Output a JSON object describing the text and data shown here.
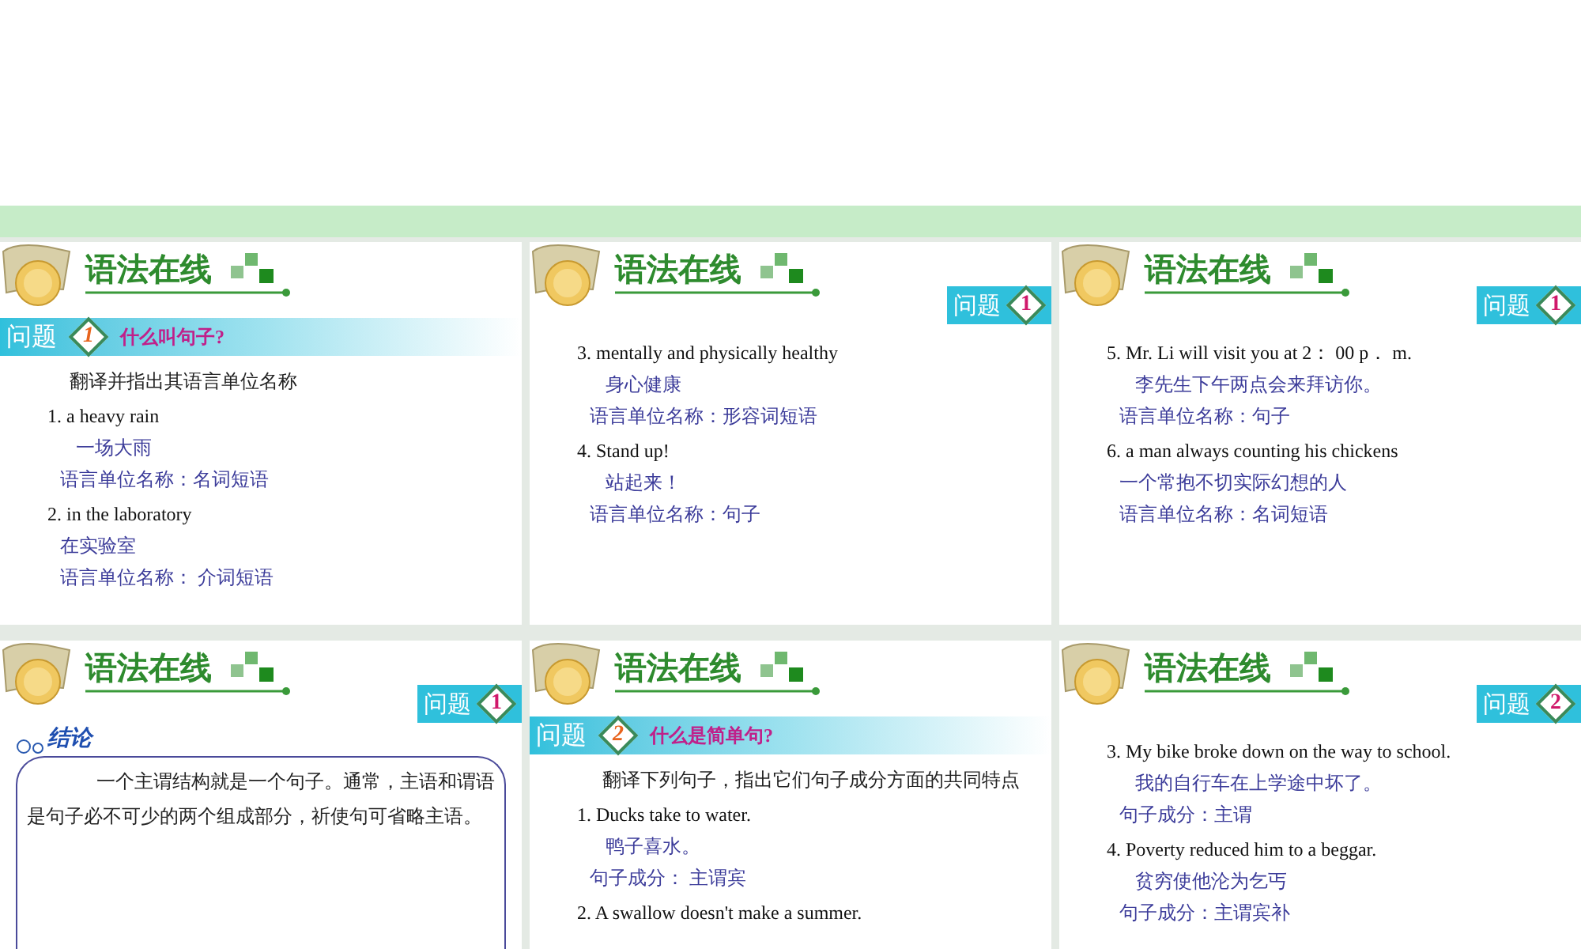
{
  "slides": [
    {
      "title": "语法在线",
      "badge": {
        "kind": "banner",
        "label": "问题",
        "number": "1",
        "question": "什么叫句子?"
      },
      "lines": [
        {
          "kind": "prompt",
          "text": "翻译并指出其语言单位名称"
        },
        {
          "kind": "english",
          "text": "1. a heavy rain"
        },
        {
          "kind": "answer",
          "text": "一场大雨"
        },
        {
          "kind": "label",
          "text": "语言单位名称：名词短语"
        },
        {
          "kind": "english",
          "text": "2. in the laboratory"
        },
        {
          "kind": "label",
          "text": "在实验室"
        },
        {
          "kind": "label",
          "text": "语言单位名称：  介词短语"
        }
      ]
    },
    {
      "title": "语法在线",
      "badge": {
        "kind": "tab",
        "label": "问题",
        "number": "1"
      },
      "lines": [
        {
          "kind": "english",
          "text": "3. mentally and physically healthy"
        },
        {
          "kind": "answer",
          "text": "身心健康"
        },
        {
          "kind": "label",
          "text": "语言单位名称：形容词短语"
        },
        {
          "kind": "english",
          "text": "4. Stand up!"
        },
        {
          "kind": "answer",
          "text": "站起来！"
        },
        {
          "kind": "label",
          "text": "语言单位名称：句子"
        }
      ]
    },
    {
      "title": "语法在线",
      "badge": {
        "kind": "tab",
        "label": "问题",
        "number": "1"
      },
      "lines": [
        {
          "kind": "english",
          "text": "5. Mr. Li will visit you at 2： 00 p． m."
        },
        {
          "kind": "answer",
          "text": "李先生下午两点会来拜访你。"
        },
        {
          "kind": "label",
          "text": "语言单位名称：句子"
        },
        {
          "kind": "english",
          "text": "6. a man always counting his chickens"
        },
        {
          "kind": "label",
          "text": "一个常抱不切实际幻想的人"
        },
        {
          "kind": "label",
          "text": "语言单位名称：名词短语"
        }
      ]
    },
    {
      "title": "语法在线",
      "badge": {
        "kind": "tab",
        "label": "问题",
        "number": "1"
      },
      "conclusion": {
        "heading": "结论",
        "text": "一个主谓结构就是一个句子。通常，主语和谓语是句子必不可少的两个组成部分，祈使句可省略主语。"
      }
    },
    {
      "title": "语法在线",
      "badge": {
        "kind": "banner",
        "label": "问题",
        "number": "2",
        "question": "什么是简单句?"
      },
      "lines": [
        {
          "kind": "paragraph",
          "text": "翻译下列句子，指出它们句子成分方面的共同特点"
        },
        {
          "kind": "english",
          "text": "1. Ducks take to water."
        },
        {
          "kind": "answer",
          "text": "鸭子喜水。"
        },
        {
          "kind": "label",
          "text": "句子成分：  主谓宾"
        },
        {
          "kind": "english",
          "text": "2. A swallow doesn't make a summer."
        }
      ]
    },
    {
      "title": "语法在线",
      "badge": {
        "kind": "tab",
        "label": "问题",
        "number": "2"
      },
      "lines": [
        {
          "kind": "english",
          "text": "3. My bike broke down on the way to school."
        },
        {
          "kind": "answer",
          "text": "我的自行车在上学途中坏了。"
        },
        {
          "kind": "label",
          "text": "句子成分：主谓"
        },
        {
          "kind": "english",
          "text": "4. Poverty reduced him to a beggar."
        },
        {
          "kind": "answer",
          "text": "贫穷使他沦为乞丐"
        },
        {
          "kind": "label",
          "text": "句子成分：主谓宾补"
        }
      ]
    }
  ]
}
